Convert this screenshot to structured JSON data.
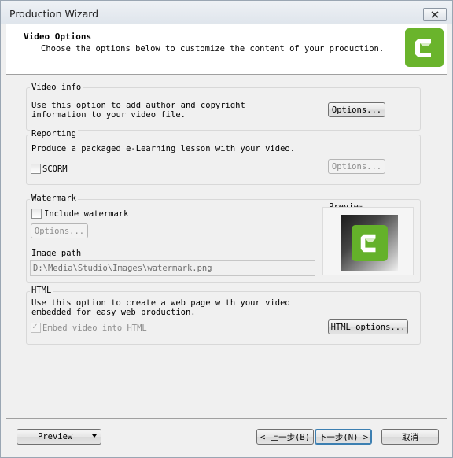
{
  "window": {
    "title": "Production Wizard"
  },
  "header": {
    "title": "Video Options",
    "subtitle": "Choose the options below to customize the content of your production."
  },
  "video_info": {
    "label": "Video info",
    "description_line1": "Use this option to add author and copyright",
    "description_line2": "information to your video file.",
    "options_button": "Options..."
  },
  "reporting": {
    "label": "Reporting",
    "description": "Produce a packaged e-Learning lesson with your video.",
    "scorm_label": "SCORM",
    "scorm_checked": false,
    "options_button": "Options..."
  },
  "watermark": {
    "label": "Watermark",
    "include_label": "Include watermark",
    "include_checked": false,
    "options_button": "Options...",
    "image_path_label": "Image path",
    "image_path_value": "D:\\Media\\Studio\\Images\\watermark.png",
    "preview_label": "Preview"
  },
  "html": {
    "label": "HTML",
    "description_line1": "Use this option to create a web page with your video",
    "description_line2": "embedded for easy web production.",
    "embed_label": "Embed video into HTML",
    "embed_checked": true,
    "options_button": "HTML options..."
  },
  "footer": {
    "preview_button": "Preview",
    "back_button": "< 上一步(B)",
    "next_button": "下一步(N) >",
    "cancel_button": "取消"
  },
  "colors": {
    "brand_green": "#6ab42c",
    "default_button_border": "#3c7fb1"
  }
}
